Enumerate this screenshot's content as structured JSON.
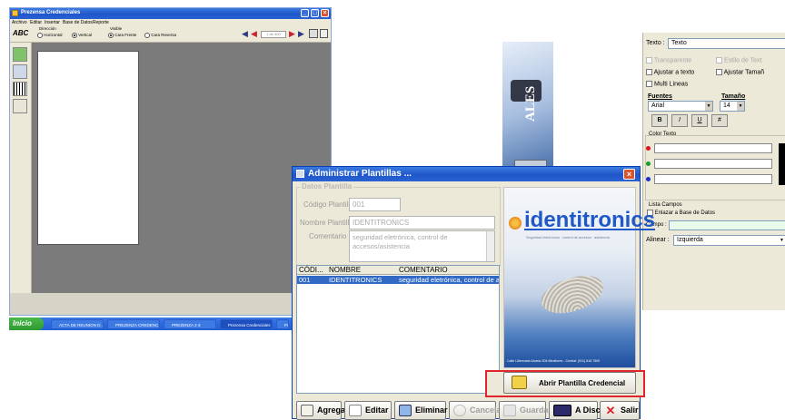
{
  "app": {
    "title": "Prezensa Credenciales",
    "menu": [
      "Archivo",
      "Editar",
      "Insertar",
      "Base de Datos",
      "Reporte"
    ],
    "direccion_label": "Dirección",
    "direccion_options": [
      "Horizontal",
      "Vertical"
    ],
    "visible_label": "Visible",
    "visible_options": [
      "Cara Frente",
      "Cara Reversa"
    ],
    "page_counter": "1 de 500",
    "side_banner_text": "ALES"
  },
  "taskbar": {
    "start_label": "Inicio",
    "items": [
      "ACTA DE REUNION D...",
      "PREZENZA CREDENC...",
      "PREZENZA 2-3",
      "Prezensa Credenciales",
      "Pr"
    ]
  },
  "properties": {
    "texto_label": "Texto :",
    "texto_value": "Texto",
    "transparente": "Transparente",
    "estilo_texto": "Estilo de Text",
    "ajustar_texto": "Ajustar a texto",
    "ajustar_tamano": "Ajustar Tamañ",
    "multi_lineas": "Multi Lineas",
    "fuentes_label": "Fuentes",
    "fuente_value": "Arial",
    "tamano_label": "Tamaño",
    "tamano_value": "14",
    "style_buttons": [
      "B",
      "I",
      "U",
      "#"
    ],
    "color_texto_label": "Color Texto",
    "color_dots": [
      "#e0101a",
      "#1a9e2a",
      "#1a2ec8"
    ],
    "lista_campos_label": "Lista Campos",
    "enlazar_label": "Enlazar a Base de Datos",
    "campo_label": "Campo :",
    "alinear_label": "Alinear :",
    "alinear_value": "Izquierda"
  },
  "dialog": {
    "title": "Administrar Plantillas ...",
    "group_title": "Datos Plantilla",
    "codigo_label": "Código Plantilla :",
    "codigo_value": "001",
    "nombre_label": "Nombre Plantilla :",
    "nombre_value": "IDENTITRONICS",
    "comentario_label": "Comentario :",
    "comentario_value": "seguridad eletrónica, control de accesos/asistencia",
    "columns": [
      "CÓDI...",
      "NOMBRE",
      "COMENTARIO"
    ],
    "rows": [
      {
        "code": "001",
        "nombre": "IDENTITRONICS",
        "comentario": "seguridad eletrónica, control de ac..."
      }
    ],
    "brand": "identitronics",
    "brand_tagline": "Seguridad electrónica · control de accesos · asistencia",
    "address": "Calle Lilienruste Aloedo 304 Miraflores - Central: (511) 616 7500",
    "abrir_button": "Abrir Plantilla Credencial",
    "buttons": [
      "Agregar",
      "Editar",
      "Eliminar",
      "Cancelar",
      "Guardar",
      "A Disco",
      "Salir"
    ]
  },
  "colors": {
    "highlight_border": "#e0252c",
    "selection_row": "#316ac5",
    "brand_blue": "#1f58c8",
    "workspace_gray": "#7b7b7b"
  }
}
